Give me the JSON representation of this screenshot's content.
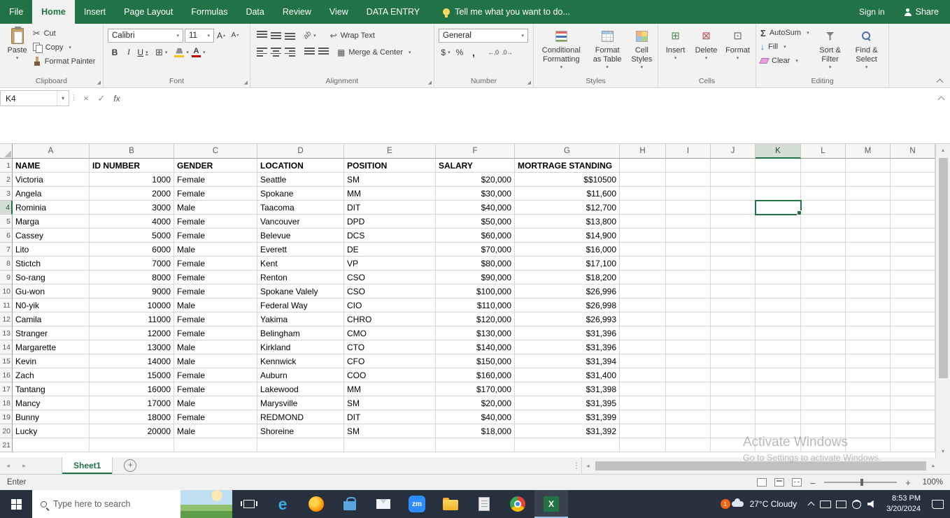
{
  "tab_bar": {
    "tabs": [
      "File",
      "Home",
      "Insert",
      "Page Layout",
      "Formulas",
      "Data",
      "Review",
      "View",
      "DATA ENTRY"
    ],
    "active_tab": "Home",
    "tell_me": "Tell me what you want to do...",
    "sign_in": "Sign in",
    "share": "Share"
  },
  "ribbon": {
    "clipboard": {
      "label": "Clipboard",
      "paste": "Paste",
      "cut": "Cut",
      "copy": "Copy",
      "format_painter": "Format Painter"
    },
    "font": {
      "label": "Font",
      "font_name": "Calibri",
      "font_size": "11"
    },
    "alignment": {
      "label": "Alignment",
      "wrap_text": "Wrap Text",
      "merge_center": "Merge & Center"
    },
    "number": {
      "label": "Number",
      "format": "General"
    },
    "styles": {
      "label": "Styles",
      "conditional_formatting": "Conditional Formatting",
      "format_as_table": "Format as Table",
      "cell_styles": "Cell Styles"
    },
    "cells": {
      "label": "Cells",
      "insert": "Insert",
      "delete": "Delete",
      "format": "Format"
    },
    "editing": {
      "label": "Editing",
      "autosum": "AutoSum",
      "fill": "Fill",
      "clear": "Clear",
      "sort_filter": "Sort & Filter",
      "find_select": "Find & Select"
    }
  },
  "icons": {
    "cut": "✂",
    "borders": "⊞",
    "merge": "▦",
    "wrap": "↩",
    "bold": "B",
    "italic": "I",
    "underline": "U",
    "font_letter": "A",
    "orientation": "ab",
    "dollar": "$",
    "percent": "%",
    "comma": ",",
    "increase_decimal": "←.0",
    "decrease_decimal": ".0→",
    "autosum": "Σ",
    "fill_down": "↓",
    "insert": "⊞",
    "delete": "⊠",
    "format": "⊡",
    "edge": "e",
    "excel": "X"
  },
  "formula_bar": {
    "name_box": "K4",
    "cancel": "×",
    "enter": "✓",
    "fx": "fx",
    "formula": ""
  },
  "grid": {
    "columns": [
      "A",
      "B",
      "C",
      "D",
      "E",
      "F",
      "G",
      "H",
      "I",
      "J",
      "K",
      "L",
      "M",
      "N"
    ],
    "selected_col": "K",
    "selected_row": 4,
    "selected_cell": "K4",
    "total_rows": 21,
    "header_row": [
      "NAME",
      "ID NUMBER",
      "GENDER",
      "LOCATION",
      "POSITION",
      "SALARY",
      "MORTRAGE STANDING"
    ],
    "data_rows": [
      [
        "Victoria",
        "1000",
        "Female",
        "Seattle",
        "SM",
        "$20,000",
        "$$10500"
      ],
      [
        "Angela",
        "2000",
        "Female",
        "Spokane",
        "MM",
        "$30,000",
        "$11,600"
      ],
      [
        "Rominia",
        "3000",
        "Male",
        "Taacoma",
        "DIT",
        "$40,000",
        "$12,700"
      ],
      [
        "Marga",
        "4000",
        "Female",
        "Vancouver",
        "DPD",
        "$50,000",
        "$13,800"
      ],
      [
        "Cassey",
        "5000",
        "Female",
        "Belevue",
        "DCS",
        "$60,000",
        "$14,900"
      ],
      [
        "Lito",
        "6000",
        "Male",
        "Everett",
        "DE",
        "$70,000",
        "$16,000"
      ],
      [
        "Stictch",
        "7000",
        "Female",
        "Kent",
        "VP",
        "$80,000",
        "$17,100"
      ],
      [
        "So-rang",
        "8000",
        "Female",
        "Renton",
        "CSO",
        "$90,000",
        "$18,200"
      ],
      [
        "Gu-won",
        "9000",
        "Female",
        "Spokane  Valely",
        "CSO",
        "$100,000",
        "$26,996"
      ],
      [
        "N0-yik",
        "10000",
        "Male",
        "Federal Way",
        "CIO",
        "$110,000",
        "$26,998"
      ],
      [
        "Camila",
        "11000",
        "Female",
        "Yakima",
        "CHRO",
        "$120,000",
        "$26,993"
      ],
      [
        "Stranger",
        "12000",
        "Female",
        "Belingham",
        "CMO",
        "$130,000",
        "$31,396"
      ],
      [
        "Margarette",
        "13000",
        "Male",
        "Kirkland",
        "CTO",
        "$140,000",
        "$31,396"
      ],
      [
        "Kevin",
        "14000",
        "Male",
        "Kennwick",
        "CFO",
        "$150,000",
        "$31,394"
      ],
      [
        "Zach",
        "15000",
        "Female",
        "Auburn",
        "COO",
        "$160,000",
        "$31,400"
      ],
      [
        "Tantang",
        "16000",
        "Female",
        "Lakewood",
        "MM",
        "$170,000",
        "$31,398"
      ],
      [
        "Mancy",
        "17000",
        "Male",
        "Marysville",
        "SM",
        "$20,000",
        "$31,395"
      ],
      [
        "Bunny",
        "18000",
        "Female",
        "REDMOND",
        "DIT",
        "$40,000",
        "$31,399"
      ],
      [
        "Lucky",
        "20000",
        "Male",
        "Shoreine",
        "SM",
        "$18,000",
        "$31,392"
      ]
    ]
  },
  "sheet_bar": {
    "sheet_name": "Sheet1"
  },
  "status_bar": {
    "mode": "Enter",
    "zoom": "100%"
  },
  "taskbar": {
    "search_placeholder": "Type here to search",
    "zoom_app": "zm",
    "badge": "1",
    "weather": "27°C  Cloudy",
    "time": "8:53 PM",
    "date": "3/20/2024"
  },
  "watermark": {
    "line1": "Activate Windows",
    "line2": "Go to Settings to activate Windows."
  }
}
